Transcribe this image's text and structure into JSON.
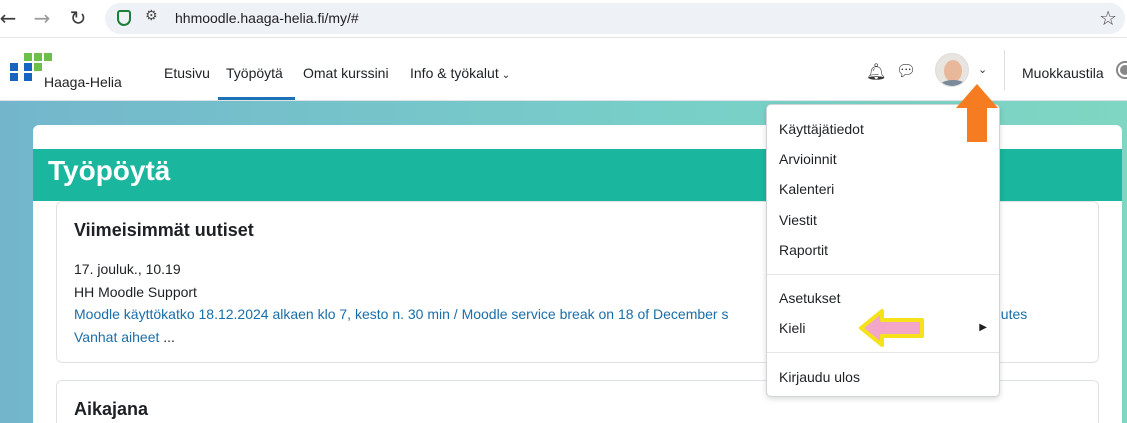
{
  "browser": {
    "url": "hhmoodle.haaga-helia.fi/my/#",
    "back_icon": "back-arrow-icon",
    "forward_icon": "forward-arrow-icon",
    "reload_icon": "reload-icon",
    "bookmark_icon": "star-icon"
  },
  "header": {
    "logo_text": "Haaga-Helia",
    "nav": [
      "Etusivu",
      "Työpöytä",
      "Omat kurssini",
      "Info & työkalut"
    ],
    "active_nav": "Työpöytä",
    "edit_mode_label": "Muokkaustila",
    "brand_colors": {
      "logo_blue": "#1565c0",
      "logo_green": "#6cc04a"
    }
  },
  "page": {
    "title": "Työpöytä",
    "title_band_color": "#1ab69d"
  },
  "news_block": {
    "title": "Viimeisimmät uutiset",
    "date": "17. jouluk., 10.19",
    "author": "HH Moodle Support",
    "post_link": "Moodle käyttökatko 18.12.2024 alkaen klo 7, kesto n. 30 min / Moodle service break on 18 of December s",
    "post_link_tail": "nutes",
    "older_link": "Vanhat aiheet",
    "older_suffix": " ..."
  },
  "timeline_block": {
    "title": "Aikajana"
  },
  "user_menu": {
    "group1": [
      "Käyttäjätiedot",
      "Arvioinnit",
      "Kalenteri",
      "Viestit",
      "Raportit"
    ],
    "group2": [
      "Asetukset",
      "Kieli"
    ],
    "group3": [
      "Kirjaudu ulos"
    ]
  },
  "annotations": {
    "orange_arrow_color": "#f57c20",
    "pink_arrow_fill": "#f4a6c8",
    "pink_arrow_stroke": "#f5e21a"
  }
}
